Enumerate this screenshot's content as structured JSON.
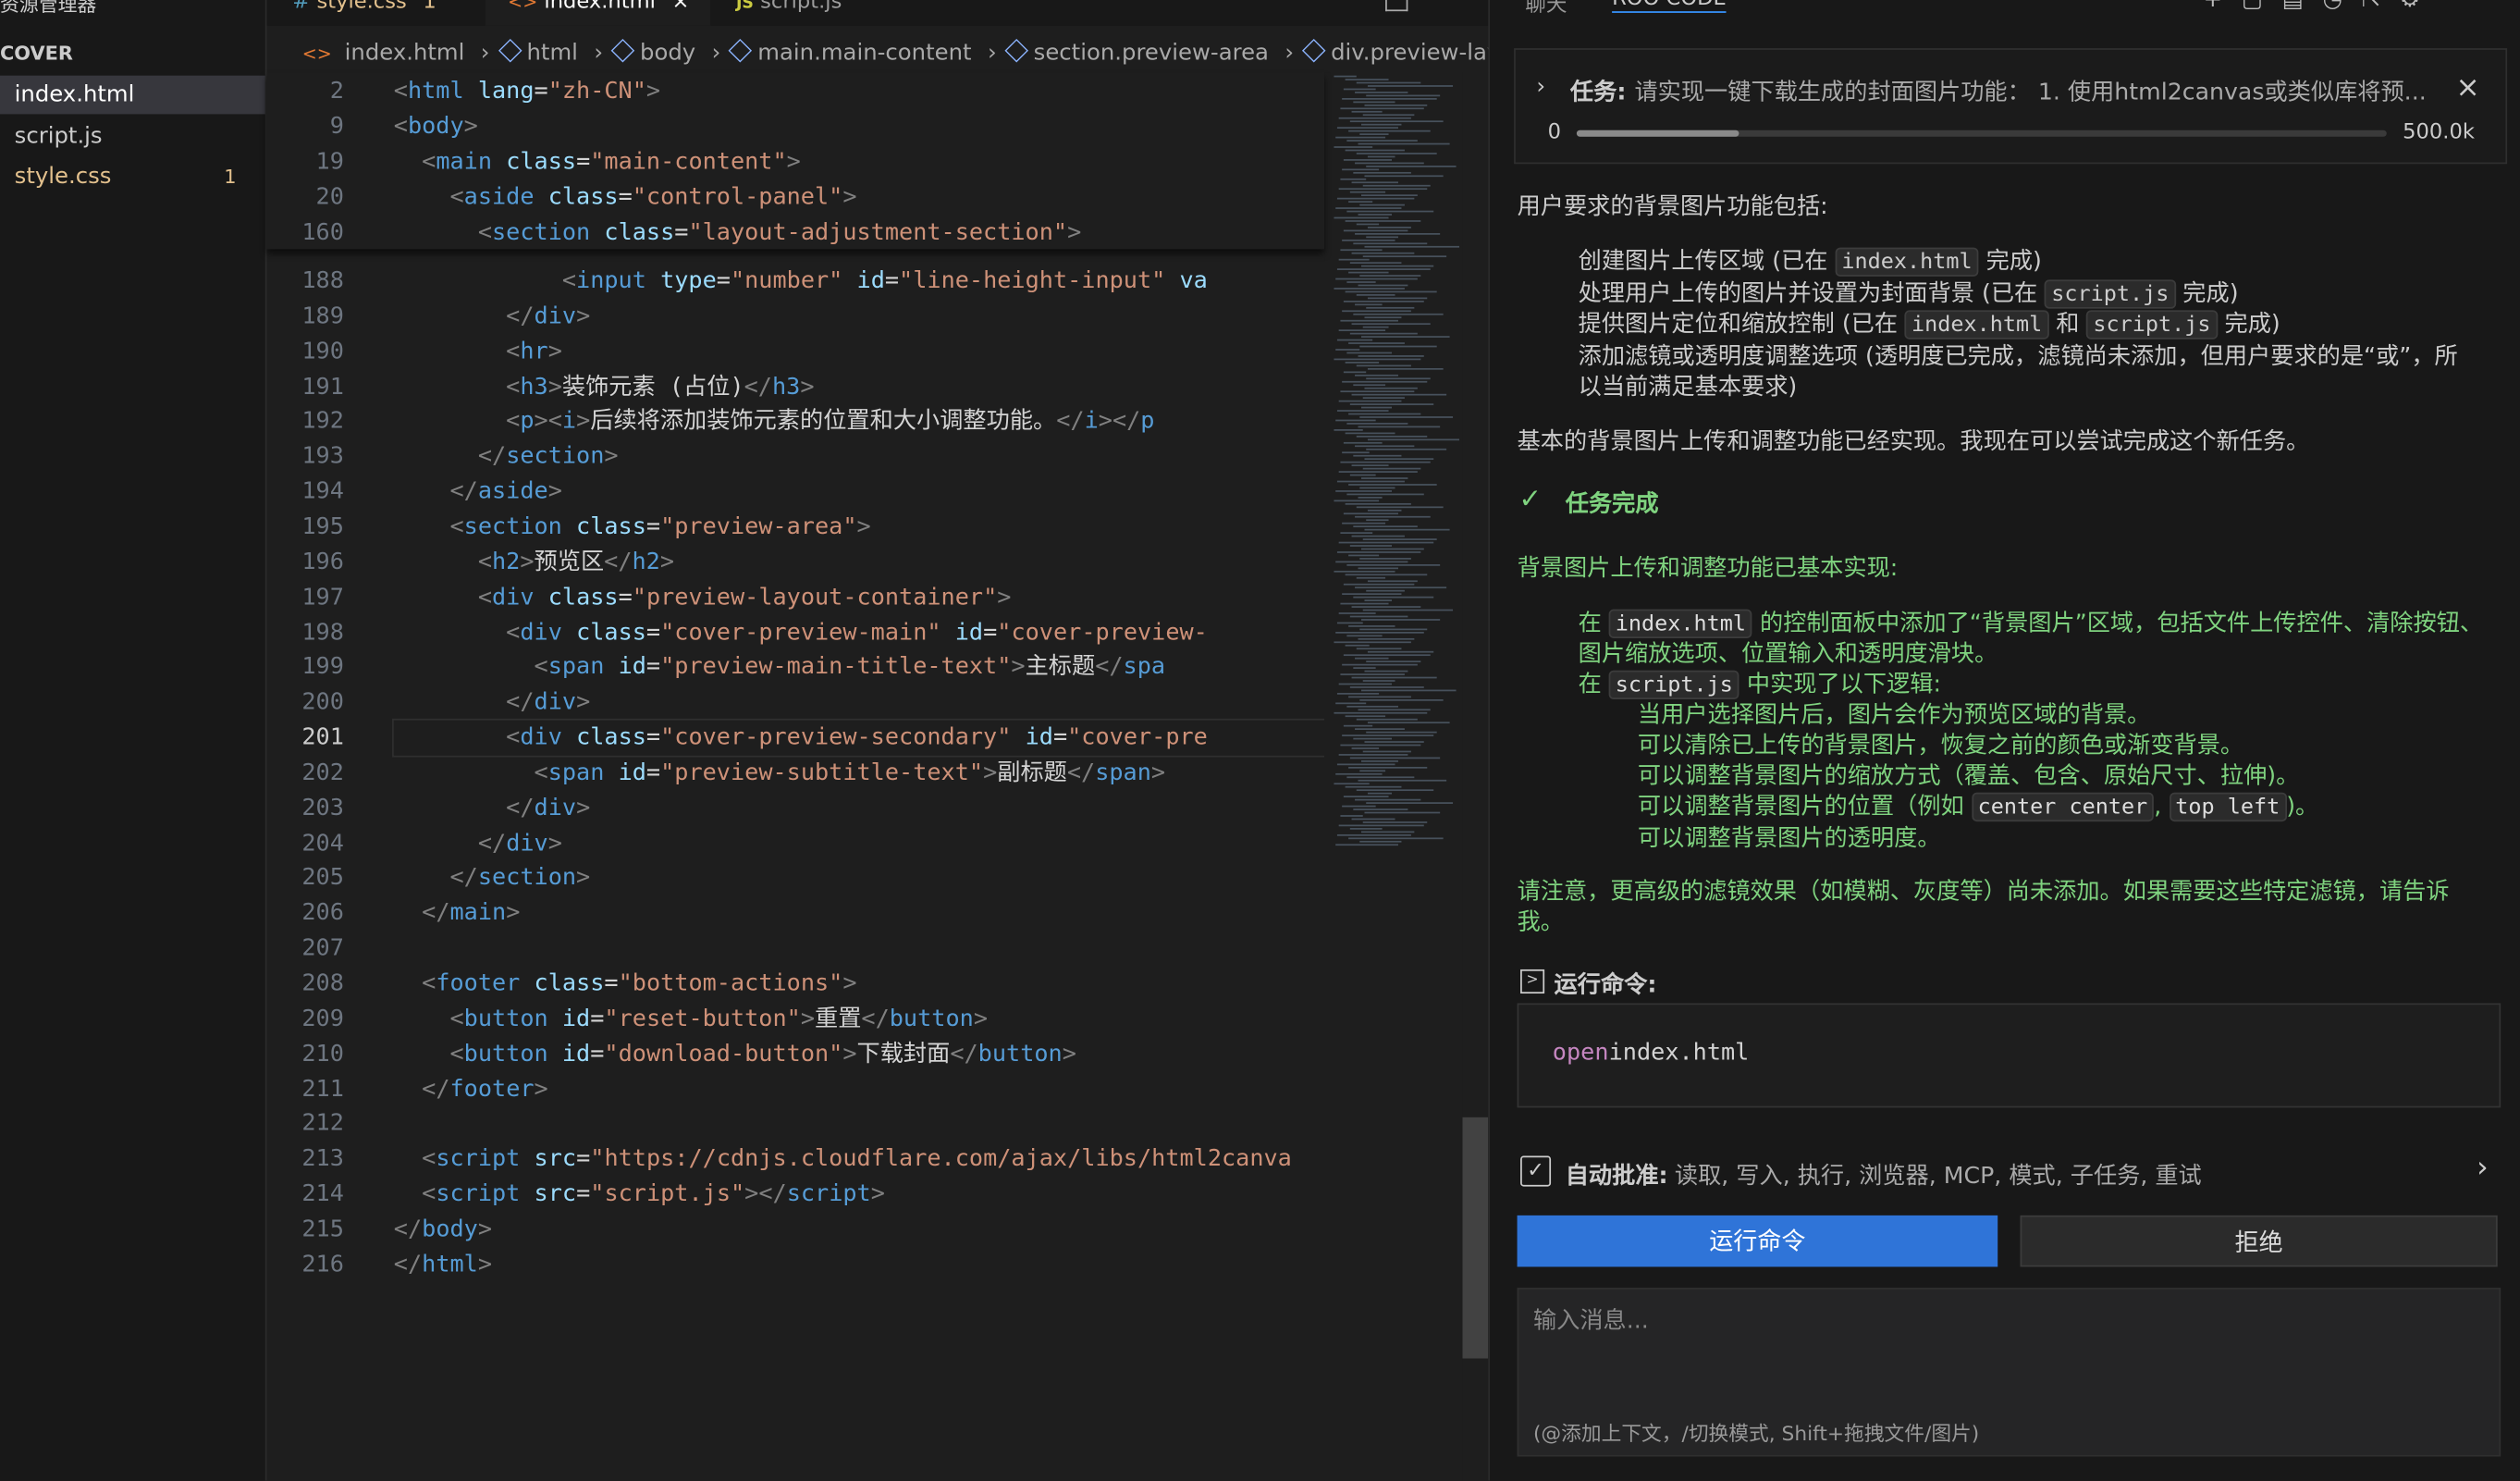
{
  "sidebar": {
    "title": "资源管理器",
    "more": "···",
    "folder": "COVER",
    "files": [
      {
        "name": "index.html",
        "badge": ""
      },
      {
        "name": "script.js",
        "badge": ""
      },
      {
        "name": "style.css",
        "badge": "1"
      }
    ]
  },
  "tabs": [
    {
      "icon": "#",
      "label": "style.css",
      "badge": "1"
    },
    {
      "icon": "<>",
      "label": "index.html",
      "close": "×"
    },
    {
      "icon": "JS",
      "label": "script.js"
    }
  ],
  "breadcrumb": [
    "index.html",
    "html",
    "body",
    "main.main-content",
    "section.preview-area",
    "div.preview-layout"
  ],
  "code_lines": [
    {
      "n": "188",
      "segs": [
        [
          "txt",
          "            "
        ],
        [
          "br",
          "<"
        ],
        [
          "tag",
          "input"
        ],
        [
          "txt",
          " "
        ],
        [
          "attr",
          "type"
        ],
        [
          "txt",
          "="
        ],
        [
          "str",
          "\"number\""
        ],
        [
          "txt",
          " "
        ],
        [
          "attr",
          "id"
        ],
        [
          "txt",
          "="
        ],
        [
          "str",
          "\"line-height-input\""
        ],
        [
          "txt",
          " "
        ],
        [
          "attr",
          "va"
        ]
      ]
    },
    {
      "n": "189",
      "segs": [
        [
          "txt",
          "        "
        ],
        [
          "br",
          "</"
        ],
        [
          "tag",
          "div"
        ],
        [
          "br",
          ">"
        ]
      ]
    },
    {
      "n": "190",
      "segs": [
        [
          "txt",
          "        "
        ],
        [
          "br",
          "<"
        ],
        [
          "tag",
          "hr"
        ],
        [
          "br",
          ">"
        ]
      ]
    },
    {
      "n": "191",
      "segs": [
        [
          "txt",
          "        "
        ],
        [
          "br",
          "<"
        ],
        [
          "tag",
          "h3"
        ],
        [
          "br",
          ">"
        ],
        [
          "txt",
          "装饰元素 (占位)"
        ],
        [
          "br",
          "</"
        ],
        [
          "tag",
          "h3"
        ],
        [
          "br",
          ">"
        ]
      ]
    },
    {
      "n": "192",
      "segs": [
        [
          "txt",
          "        "
        ],
        [
          "br",
          "<"
        ],
        [
          "tag",
          "p"
        ],
        [
          "br",
          "><"
        ],
        [
          "tag",
          "i"
        ],
        [
          "br",
          ">"
        ],
        [
          "txt",
          "后续将添加装饰元素的位置和大小调整功能。"
        ],
        [
          "br",
          "</"
        ],
        [
          "tag",
          "i"
        ],
        [
          "br",
          "></"
        ],
        [
          "tag",
          "p"
        ]
      ]
    },
    {
      "n": "193",
      "segs": [
        [
          "txt",
          "      "
        ],
        [
          "br",
          "</"
        ],
        [
          "tag",
          "section"
        ],
        [
          "br",
          ">"
        ]
      ]
    },
    {
      "n": "194",
      "segs": [
        [
          "txt",
          "    "
        ],
        [
          "br",
          "</"
        ],
        [
          "tag",
          "aside"
        ],
        [
          "br",
          ">"
        ]
      ]
    },
    {
      "n": "195",
      "segs": [
        [
          "txt",
          "    "
        ],
        [
          "br",
          "<"
        ],
        [
          "tag",
          "section"
        ],
        [
          "txt",
          " "
        ],
        [
          "attr",
          "class"
        ],
        [
          "txt",
          "="
        ],
        [
          "str",
          "\"preview-area\""
        ],
        [
          "br",
          ">"
        ]
      ]
    },
    {
      "n": "196",
      "segs": [
        [
          "txt",
          "      "
        ],
        [
          "br",
          "<"
        ],
        [
          "tag",
          "h2"
        ],
        [
          "br",
          ">"
        ],
        [
          "txt",
          "预览区"
        ],
        [
          "br",
          "</"
        ],
        [
          "tag",
          "h2"
        ],
        [
          "br",
          ">"
        ]
      ]
    },
    {
      "n": "197",
      "segs": [
        [
          "txt",
          "      "
        ],
        [
          "br",
          "<"
        ],
        [
          "tag",
          "div"
        ],
        [
          "txt",
          " "
        ],
        [
          "attr",
          "class"
        ],
        [
          "txt",
          "="
        ],
        [
          "str",
          "\"preview-layout-container\""
        ],
        [
          "br",
          ">"
        ]
      ]
    },
    {
      "n": "198",
      "segs": [
        [
          "txt",
          "        "
        ],
        [
          "br",
          "<"
        ],
        [
          "tag",
          "div"
        ],
        [
          "txt",
          " "
        ],
        [
          "attr",
          "class"
        ],
        [
          "txt",
          "="
        ],
        [
          "str",
          "\"cover-preview-main\""
        ],
        [
          "txt",
          " "
        ],
        [
          "attr",
          "id"
        ],
        [
          "txt",
          "="
        ],
        [
          "str",
          "\"cover-preview-"
        ]
      ]
    },
    {
      "n": "199",
      "segs": [
        [
          "txt",
          "          "
        ],
        [
          "br",
          "<"
        ],
        [
          "tag",
          "span"
        ],
        [
          "txt",
          " "
        ],
        [
          "attr",
          "id"
        ],
        [
          "txt",
          "="
        ],
        [
          "str",
          "\"preview-main-title-text\""
        ],
        [
          "br",
          ">"
        ],
        [
          "txt",
          "主标题"
        ],
        [
          "br",
          "</"
        ],
        [
          "tag",
          "spa"
        ]
      ]
    },
    {
      "n": "200",
      "segs": [
        [
          "txt",
          "        "
        ],
        [
          "br",
          "</"
        ],
        [
          "tag",
          "div"
        ],
        [
          "br",
          ">"
        ]
      ]
    },
    {
      "n": "201",
      "segs": [
        [
          "txt",
          "        "
        ],
        [
          "br",
          "<"
        ],
        [
          "tag",
          "div"
        ],
        [
          "txt",
          " "
        ],
        [
          "attr",
          "class"
        ],
        [
          "txt",
          "="
        ],
        [
          "str",
          "\"cover-preview-secondary\""
        ],
        [
          "txt",
          " "
        ],
        [
          "attr",
          "id"
        ],
        [
          "txt",
          "="
        ],
        [
          "str",
          "\"cover-pre"
        ]
      ],
      "current": true
    },
    {
      "n": "202",
      "segs": [
        [
          "txt",
          "          "
        ],
        [
          "br",
          "<"
        ],
        [
          "tag",
          "span"
        ],
        [
          "txt",
          " "
        ],
        [
          "attr",
          "id"
        ],
        [
          "txt",
          "="
        ],
        [
          "str",
          "\"preview-subtitle-text\""
        ],
        [
          "br",
          ">"
        ],
        [
          "txt",
          "副标题"
        ],
        [
          "br",
          "</"
        ],
        [
          "tag",
          "span"
        ],
        [
          "br",
          ">"
        ]
      ]
    },
    {
      "n": "203",
      "segs": [
        [
          "txt",
          "        "
        ],
        [
          "br",
          "</"
        ],
        [
          "tag",
          "div"
        ],
        [
          "br",
          ">"
        ]
      ]
    },
    {
      "n": "204",
      "segs": [
        [
          "txt",
          "      "
        ],
        [
          "br",
          "</"
        ],
        [
          "tag",
          "div"
        ],
        [
          "br",
          ">"
        ]
      ]
    },
    {
      "n": "205",
      "segs": [
        [
          "txt",
          "    "
        ],
        [
          "br",
          "</"
        ],
        [
          "tag",
          "section"
        ],
        [
          "br",
          ">"
        ]
      ]
    },
    {
      "n": "206",
      "segs": [
        [
          "txt",
          "  "
        ],
        [
          "br",
          "</"
        ],
        [
          "tag",
          "main"
        ],
        [
          "br",
          ">"
        ]
      ]
    },
    {
      "n": "207",
      "segs": []
    },
    {
      "n": "208",
      "segs": [
        [
          "txt",
          "  "
        ],
        [
          "br",
          "<"
        ],
        [
          "tag",
          "footer"
        ],
        [
          "txt",
          " "
        ],
        [
          "attr",
          "class"
        ],
        [
          "txt",
          "="
        ],
        [
          "str",
          "\"bottom-actions\""
        ],
        [
          "br",
          ">"
        ]
      ]
    },
    {
      "n": "209",
      "segs": [
        [
          "txt",
          "    "
        ],
        [
          "br",
          "<"
        ],
        [
          "tag",
          "button"
        ],
        [
          "txt",
          " "
        ],
        [
          "attr",
          "id"
        ],
        [
          "txt",
          "="
        ],
        [
          "str",
          "\"reset-button\""
        ],
        [
          "br",
          ">"
        ],
        [
          "txt",
          "重置"
        ],
        [
          "br",
          "</"
        ],
        [
          "tag",
          "button"
        ],
        [
          "br",
          ">"
        ]
      ]
    },
    {
      "n": "210",
      "segs": [
        [
          "txt",
          "    "
        ],
        [
          "br",
          "<"
        ],
        [
          "tag",
          "button"
        ],
        [
          "txt",
          " "
        ],
        [
          "attr",
          "id"
        ],
        [
          "txt",
          "="
        ],
        [
          "str",
          "\"download-button\""
        ],
        [
          "br",
          ">"
        ],
        [
          "txt",
          "下载封面"
        ],
        [
          "br",
          "</"
        ],
        [
          "tag",
          "button"
        ],
        [
          "br",
          ">"
        ]
      ]
    },
    {
      "n": "211",
      "segs": [
        [
          "txt",
          "  "
        ],
        [
          "br",
          "</"
        ],
        [
          "tag",
          "footer"
        ],
        [
          "br",
          ">"
        ]
      ]
    },
    {
      "n": "212",
      "segs": []
    },
    {
      "n": "213",
      "segs": [
        [
          "txt",
          "  "
        ],
        [
          "br",
          "<"
        ],
        [
          "tag",
          "script"
        ],
        [
          "txt",
          " "
        ],
        [
          "attr",
          "src"
        ],
        [
          "txt",
          "="
        ],
        [
          "str",
          "\"https://cdnjs.cloudflare.com/ajax/libs/html2canva"
        ]
      ]
    },
    {
      "n": "214",
      "segs": [
        [
          "txt",
          "  "
        ],
        [
          "br",
          "<"
        ],
        [
          "tag",
          "script"
        ],
        [
          "txt",
          " "
        ],
        [
          "attr",
          "src"
        ],
        [
          "txt",
          "="
        ],
        [
          "str",
          "\"script.js\""
        ],
        [
          "br",
          "></"
        ],
        [
          "tag",
          "script"
        ],
        [
          "br",
          ">"
        ]
      ]
    },
    {
      "n": "215",
      "segs": [
        [
          "br",
          "</"
        ],
        [
          "tag",
          "body"
        ],
        [
          "br",
          ">"
        ]
      ]
    },
    {
      "n": "216",
      "segs": [
        [
          "br",
          "</"
        ],
        [
          "tag",
          "html"
        ],
        [
          "br",
          ">"
        ]
      ]
    }
  ],
  "sticky_lines": [
    {
      "n": "2",
      "segs": [
        [
          "br",
          "<"
        ],
        [
          "tag",
          "html"
        ],
        [
          "txt",
          " "
        ],
        [
          "attr",
          "lang"
        ],
        [
          "txt",
          "="
        ],
        [
          "str",
          "\"zh-CN\""
        ],
        [
          "br",
          ">"
        ]
      ]
    },
    {
      "n": "9",
      "segs": [
        [
          "br",
          "<"
        ],
        [
          "tag",
          "body"
        ],
        [
          "br",
          ">"
        ]
      ]
    },
    {
      "n": "19",
      "segs": [
        [
          "txt",
          "  "
        ],
        [
          "br",
          "<"
        ],
        [
          "tag",
          "main"
        ],
        [
          "txt",
          " "
        ],
        [
          "attr",
          "class"
        ],
        [
          "txt",
          "="
        ],
        [
          "str",
          "\"main-content\""
        ],
        [
          "br",
          ">"
        ]
      ]
    },
    {
      "n": "20",
      "segs": [
        [
          "txt",
          "    "
        ],
        [
          "br",
          "<"
        ],
        [
          "tag",
          "aside"
        ],
        [
          "txt",
          " "
        ],
        [
          "attr",
          "class"
        ],
        [
          "txt",
          "="
        ],
        [
          "str",
          "\"control-panel\""
        ],
        [
          "br",
          ">"
        ]
      ]
    },
    {
      "n": "160",
      "segs": [
        [
          "txt",
          "      "
        ],
        [
          "br",
          "<"
        ],
        [
          "tag",
          "section"
        ],
        [
          "txt",
          " "
        ],
        [
          "attr",
          "class"
        ],
        [
          "txt",
          "="
        ],
        [
          "str",
          "\"layout-adjustment-section\""
        ],
        [
          "br",
          ">"
        ]
      ]
    }
  ],
  "panel": {
    "tabs": [
      "聊天",
      "ROO CODE"
    ],
    "task_label": "任务:",
    "task_text": "请实现一键下载生成的封面图片功能： 1. 使用html2canvas或类似库将预...",
    "close": "×",
    "progress_min": "0",
    "progress_max": "500.0k",
    "progress_fraction": 0.2,
    "para1": "用户要求的背景图片功能包括:",
    "items": [
      {
        "pre": "创建图片上传区域 (已在 ",
        "code": "index.html",
        "post": " 完成)"
      },
      {
        "pre": "处理用户上传的图片并设置为封面背景 (已在 ",
        "code": "script.js",
        "post": " 完成)"
      },
      {
        "pre": "提供图片定位和缩放控制 (已在 ",
        "code": "index.html",
        "mid": " 和 ",
        "code2": "script.js",
        "post": " 完成)"
      }
    ],
    "item4a": "添加滤镜或透明度调整选项 (透明度已完成，滤镜尚未添加，但用户要求的是“或”，所",
    "item4b": "以当前满足基本要求)",
    "para2": "基本的背景图片上传和调整功能已经实现。我现在可以尝试完成这个新任务。",
    "done_label": "任务完成",
    "done_head": "背景图片上传和调整功能已基本实现:",
    "g1_pre": "在 ",
    "g1_code": "index.html",
    "g1_post": " 的控制面板中添加了“背景图片”区域，包括文件上传控件、清除按钮、",
    "g1_line2": "图片缩放选项、位置输入和透明度滑块。",
    "g2_pre": "在 ",
    "g2_code": "script.js",
    "g2_post": " 中实现了以下逻辑:",
    "sub": [
      "当用户选择图片后，图片会作为预览区域的背景。",
      "可以清除已上传的背景图片，恢复之前的颜色或渐变背景。",
      "可以调整背景图片的缩放方式（覆盖、包含、原始尺寸、拉伸)。"
    ],
    "sub4_pre": "可以调整背景图片的位置（例如 ",
    "sub4_code1": "center center",
    "sub4_mid": ", ",
    "sub4_code2": "top left",
    "sub4_post": ")。",
    "sub5": "可以调整背景图片的透明度。",
    "note_a": "请注意，更高级的滤镜效果（如模糊、灰度等）尚未添加。如果需要这些特定滤镜，请告诉",
    "note_b": "我。",
    "run_label": "运行命令:",
    "command_kw": "open",
    "command_arg": " index.html",
    "auto_label": "自动批准:",
    "auto_text": "读取, 写入, 执行, 浏览器, MCP, 模式, 子任务, 重试",
    "run_button": "运行命令",
    "reject_button": "拒绝",
    "input_placeholder": "输入消息...",
    "input_hint": "(@添加上下文，/切换模式, Shift+拖拽文件/图片)"
  },
  "colors": {
    "accent": "#2f74d8",
    "green": "#7fd37f",
    "editor_bg": "#1e1e1e"
  }
}
